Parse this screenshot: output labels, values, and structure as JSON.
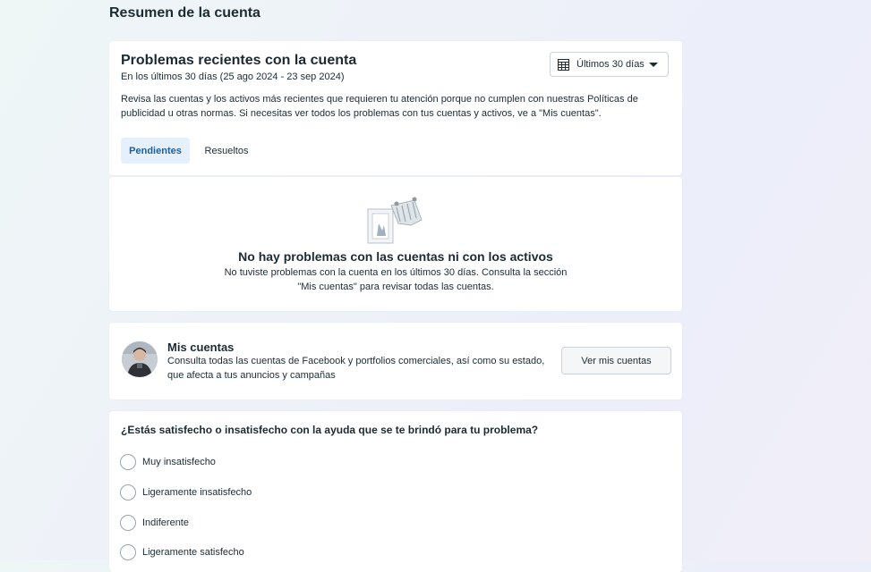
{
  "page": {
    "title": "Resumen de la cuenta"
  },
  "issues": {
    "title": "Problemas recientes con la cuenta",
    "subtitle": "En los últimos 30 días (25 ago 2024 - 23 sep 2024)",
    "description": "Revisa las cuentas y los activos más recientes que requieren tu atención porque no cumplen con nuestras Políticas de publicidad u otras normas. Si necesitas ver todos los problemas con tus cuentas y activos, ve a \"Mis cuentas\".",
    "date_filter": {
      "label": "Últimos 30 días",
      "icon": "calendar-icon"
    },
    "tabs": [
      {
        "label": "Pendientes",
        "active": true
      },
      {
        "label": "Resueltos",
        "active": false
      }
    ]
  },
  "empty_state": {
    "title": "No hay problemas con las cuentas ni con los activos",
    "text": "No tuviste problemas con la cuenta en los últimos 30 días. Consulta la sección \"Mis cuentas\" para revisar todas las cuentas."
  },
  "accounts": {
    "title": "Mis cuentas",
    "description": "Consulta todas las cuentas de Facebook y portfolios comerciales, así como su estado, que afecta a tus anuncios y campañas",
    "button_label": "Ver mis cuentas"
  },
  "survey": {
    "question": "¿Estás satisfecho o insatisfecho con la ayuda que se te brindó para tu problema?",
    "options": [
      "Muy insatisfecho",
      "Ligeramente insatisfecho",
      "Indiferente",
      "Ligeramente satisfecho"
    ]
  },
  "colors": {
    "accent": "#1d5f9d",
    "tab_active_bg": "#e6f0fa",
    "text": "#1c2b33",
    "border": "#cbd2d9"
  }
}
